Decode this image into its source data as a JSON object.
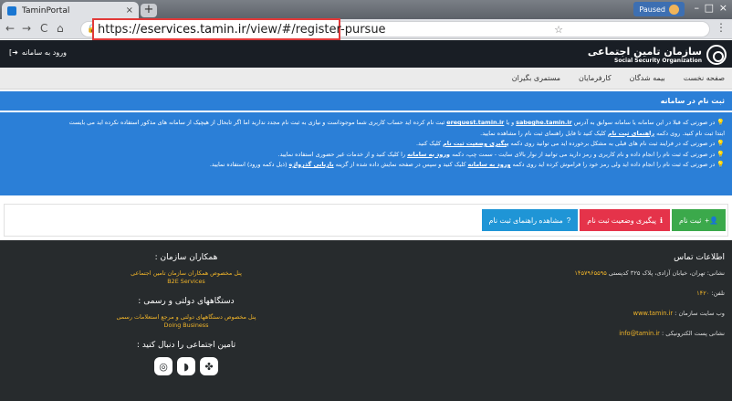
{
  "browser": {
    "tab_title": "TaminPortal",
    "tab_close": "×",
    "new_tab": "+",
    "back": "←",
    "forward": "→",
    "reload": "C",
    "home": "⌂",
    "url_scheme": "https://",
    "url_host": "eservices.tamin.ir",
    "url_path": "/view/#/register-pursue",
    "profile_label": "Paused",
    "menu": "⋮",
    "minimize": "–",
    "maximize": "□",
    "close": "×"
  },
  "header": {
    "logo_fa": "سازمان تامین اجتماعی",
    "logo_en": "Social Security Organization",
    "login_label": "ورود به سامانه"
  },
  "nav": {
    "items": [
      "صفحه نخست",
      "بیمه شدگان",
      "کارفرمایان",
      "مستمری بگیران"
    ]
  },
  "panel": {
    "title": "ثبت نام در سامانه",
    "line1_a": "در صورتی که قبلا در این سامانه یا سامانه سوابق به آدرس ",
    "line1_link1": "sabeghe.tamin.ir",
    "line1_b": " و یا ",
    "line1_link2": "erequest.tamin.ir",
    "line1_c": " ثبت نام کرده اید حساب کاربری شما موجوداست و نیازی به ثبت نام مجدد ندارید اما اگر تابحال از هیچیک از سامانه های مذکور استفاده نکرده اید می بایست",
    "line2_a": "ابتدا ثبت نام کنید. روی دکمه ",
    "line2_link": "راهنمای ثبت نام",
    "line2_b": " کلیک کنید تا فایل راهنمای ثبت نام را مشاهده نمایید.",
    "line3_a": "در صورتی که در فرایند ثبت نام های قبلی به مشکل برخورده اید می توانید روی دکمه ",
    "line3_link": "پیگیری وضعیت ثبت نام",
    "line3_b": " کلیک کنید.",
    "line4_a": "در صورتی که ثبت نام را انجام داده و نام کاربری و رمز دارید می توانید از نوار بالای سایت - سمت چپ، دکمه ",
    "line4_link": "ورود به سامانه",
    "line4_b": " را کلیک کنید و از خدمات غیر حضوری استفاده نمایید.",
    "line5_a": "در صورتی که ثبت نام را انجام داده اید ولی رمز خود را فراموش کرده اید روی دکمه ",
    "line5_link1": "ورود به سامانه",
    "line5_b": " کلیک کنید و سپس در صفحه نمایش داده شده از گزینه ",
    "line5_link2": "بازیابی گذرواژه",
    "line5_c": " (ذیل دکمه ورود) استفاده نمایید."
  },
  "actions": {
    "register": "ثبت نام",
    "pursue": "پیگیری وضعیت ثبت نام",
    "guide": "مشاهده راهنمای ثبت نام"
  },
  "footer": {
    "contact_title": "اطلاعات تماس",
    "address_label": "نشانی: تهران، خیابان آزادی، پلاک ۳۲۵ کدپستی ",
    "address_value": "۱۴۵۷۹۶۵۵۹۵",
    "phone_label": "تلفن: ",
    "phone_value": "۱۴۲۰",
    "website_label": "وب سایت سازمان : ",
    "website_value": "www.tamin.ir",
    "email_label": "نشانی پست الکترونیکی : ",
    "email_value": "info@tamin.ir",
    "partners_title": "همکاران سازمان :",
    "partners_link_fa": "پنل مخصوص همکاران سازمان تامین اجتماعی",
    "partners_link_en": "B2E Services",
    "gov_title": "دستگاههای دولتی و رسمی :",
    "gov_link_fa": "پنل مخصوص دستگاههای دولتی و مرجع استعلامات رسمی",
    "gov_link_en": "Doing Business",
    "follow_title": "تامین اجتماعی را دنبال کنید :"
  },
  "colors": {
    "panel_blue": "#2b7fd7",
    "footer_bg": "#272b2d",
    "accent_gold": "#f0b429",
    "btn_green": "#3ba94b",
    "btn_red": "#e5334a",
    "btn_blue": "#1f95d6"
  }
}
